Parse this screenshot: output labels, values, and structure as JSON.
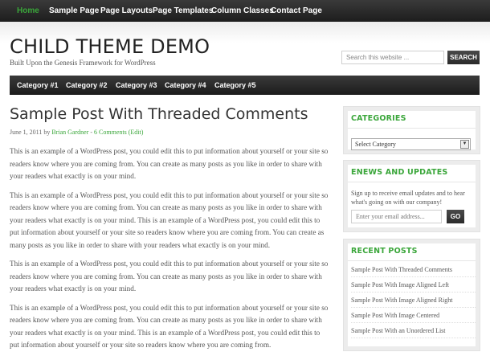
{
  "topnav": {
    "items": [
      "Home",
      "Sample Page",
      "Page Layouts",
      "Page Templates",
      "Column Classes",
      "Contact Page"
    ]
  },
  "header": {
    "title": "CHILD THEME DEMO",
    "description": "Built Upon the Genesis Framework for WordPress",
    "search_placeholder": "Search this website ...",
    "search_button": "SEARCH"
  },
  "catnav": {
    "items": [
      "Category #1",
      "Category #2",
      "Category #3",
      "Category #4",
      "Category #5"
    ]
  },
  "post": {
    "title": "Sample Post With Threaded Comments",
    "date": "June 1, 2011",
    "by": "by",
    "author": "Brian Gardner",
    "comments": "6 Comments",
    "edit": "(Edit)",
    "paragraphs": [
      "This is an example of a WordPress post, you could edit this to put information about yourself or your site so readers know where you are coming from. You can create as many posts as you like in order to share with your readers what exactly is on your mind.",
      "This is an example of a WordPress post, you could edit this to put information about yourself or your site so readers know where you are coming from. You can create as many posts as you like in order to share with your readers what exactly is on your mind. This is an example of a WordPress post, you could edit this to put information about yourself or your site so readers know where you are coming from. You can create as many posts as you like in order to share with your readers what exactly is on your mind.",
      "This is an example of a WordPress post, you could edit this to put information about yourself or your site so readers know where you are coming from. You can create as many posts as you like in order to share with your readers what exactly is on your mind.",
      "This is an example of a WordPress post, you could edit this to put information about yourself or your site so readers know where you are coming from. You can create as many posts as you like in order to share with your readers what exactly is on your mind. This is an example of a WordPress post, you could edit this to put information about yourself or your site so readers know where you are coming from."
    ]
  },
  "sidebar": {
    "categories": {
      "title": "CATEGORIES",
      "select_value": "Select Category"
    },
    "enews": {
      "title": "ENEWS AND UPDATES",
      "text": "Sign up to receive email updates and to hear what's going on with our company!",
      "placeholder": "Enter your email address...",
      "button": "GO"
    },
    "recent": {
      "title": "RECENT POSTS",
      "items": [
        "Sample Post With Threaded Comments",
        "Sample Post With Image Aligned Left",
        "Sample Post With Image Aligned Right",
        "Sample Post With Image Centered",
        "Sample Post With an Unordered List"
      ]
    }
  },
  "colors": {
    "accent": "#3aa63a",
    "nav_bg": "#2a2a2a",
    "text": "#555555"
  }
}
